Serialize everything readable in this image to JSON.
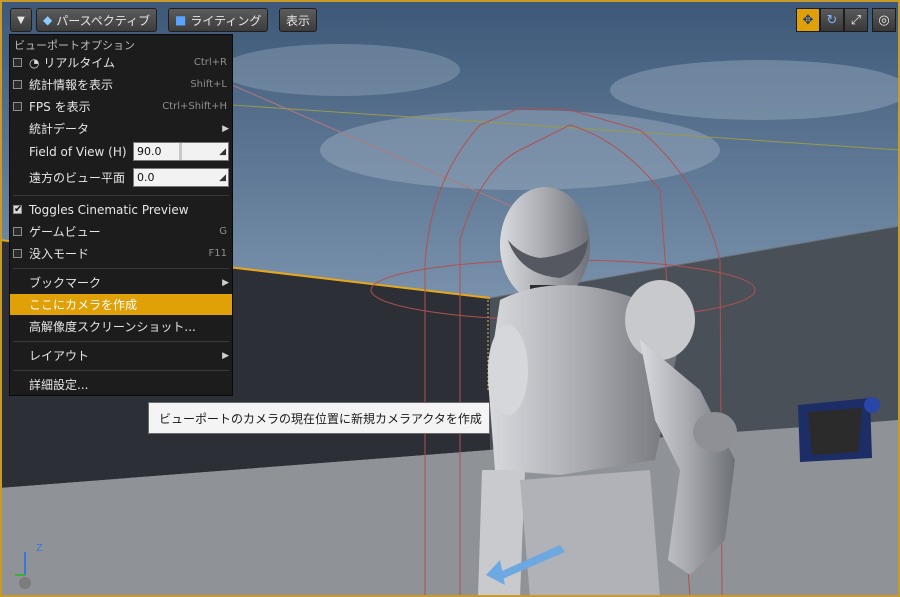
{
  "toolbar": {
    "perspective_label": "パースペクティブ",
    "lighting_label": "ライティング",
    "show_label": "表示",
    "dropdown_icon": "chevron-down-icon"
  },
  "menu": {
    "header": "ビューポートオプション",
    "realtime": {
      "label": "リアルタイム",
      "shortcut": "Ctrl+R",
      "checked": false
    },
    "stats_show": {
      "label": "統計情報を表示",
      "shortcut": "Shift+L",
      "checked": false
    },
    "fps": {
      "label": "FPS を表示",
      "shortcut": "Ctrl+Shift+H",
      "checked": false
    },
    "stat_data": {
      "label": "統計データ"
    },
    "fov": {
      "label": "Field of View (H)",
      "value": "90.0"
    },
    "far_plane": {
      "label": "遠方のビュー平面",
      "value": "0.0"
    },
    "cinematic": {
      "label": "Toggles Cinematic Preview",
      "checked": true,
      "check_glyph": "✔"
    },
    "game_view": {
      "label": "ゲームビュー",
      "shortcut": "G",
      "checked": false
    },
    "immersive": {
      "label": "没入モード",
      "shortcut": "F11",
      "checked": false
    },
    "bookmarks": {
      "label": "ブックマーク"
    },
    "create_camera": {
      "label": "ここにカメラを作成"
    },
    "hires": {
      "label": "高解像度スクリーンショット..."
    },
    "layout": {
      "label": "レイアウト"
    },
    "advanced": {
      "label": "詳細設定..."
    }
  },
  "tooltip": {
    "text": "ビューポートのカメラの現在位置に新規カメラアクタを作成"
  },
  "axis": {
    "z": "Z"
  },
  "colors": {
    "highlight": "#e0a008",
    "menu_bg": "#1c1c1c",
    "viewport_border": "#c89a2a"
  }
}
